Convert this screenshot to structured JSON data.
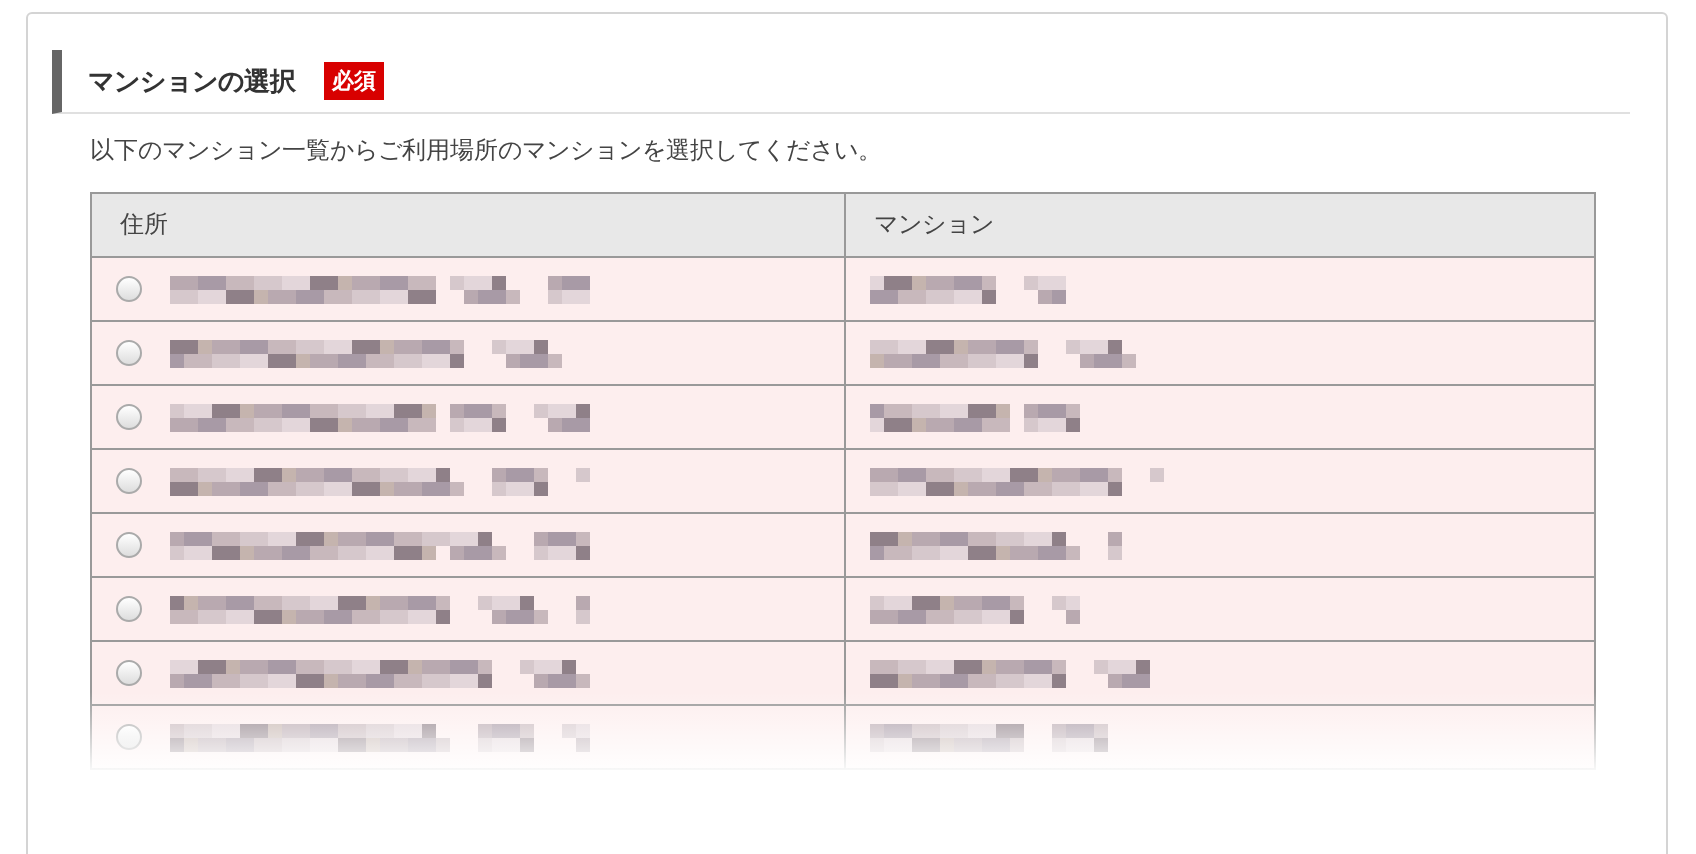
{
  "section": {
    "title": "マンションの選択",
    "badge": "必須",
    "description": "以下のマンション一覧からご利用場所のマンションを選択してください。"
  },
  "table": {
    "columns": [
      "住所",
      "マンション"
    ],
    "rows": [
      {
        "selected": false
      },
      {
        "selected": false
      },
      {
        "selected": false
      },
      {
        "selected": false
      },
      {
        "selected": false
      },
      {
        "selected": false
      },
      {
        "selected": false
      },
      {
        "selected": false
      }
    ]
  }
}
